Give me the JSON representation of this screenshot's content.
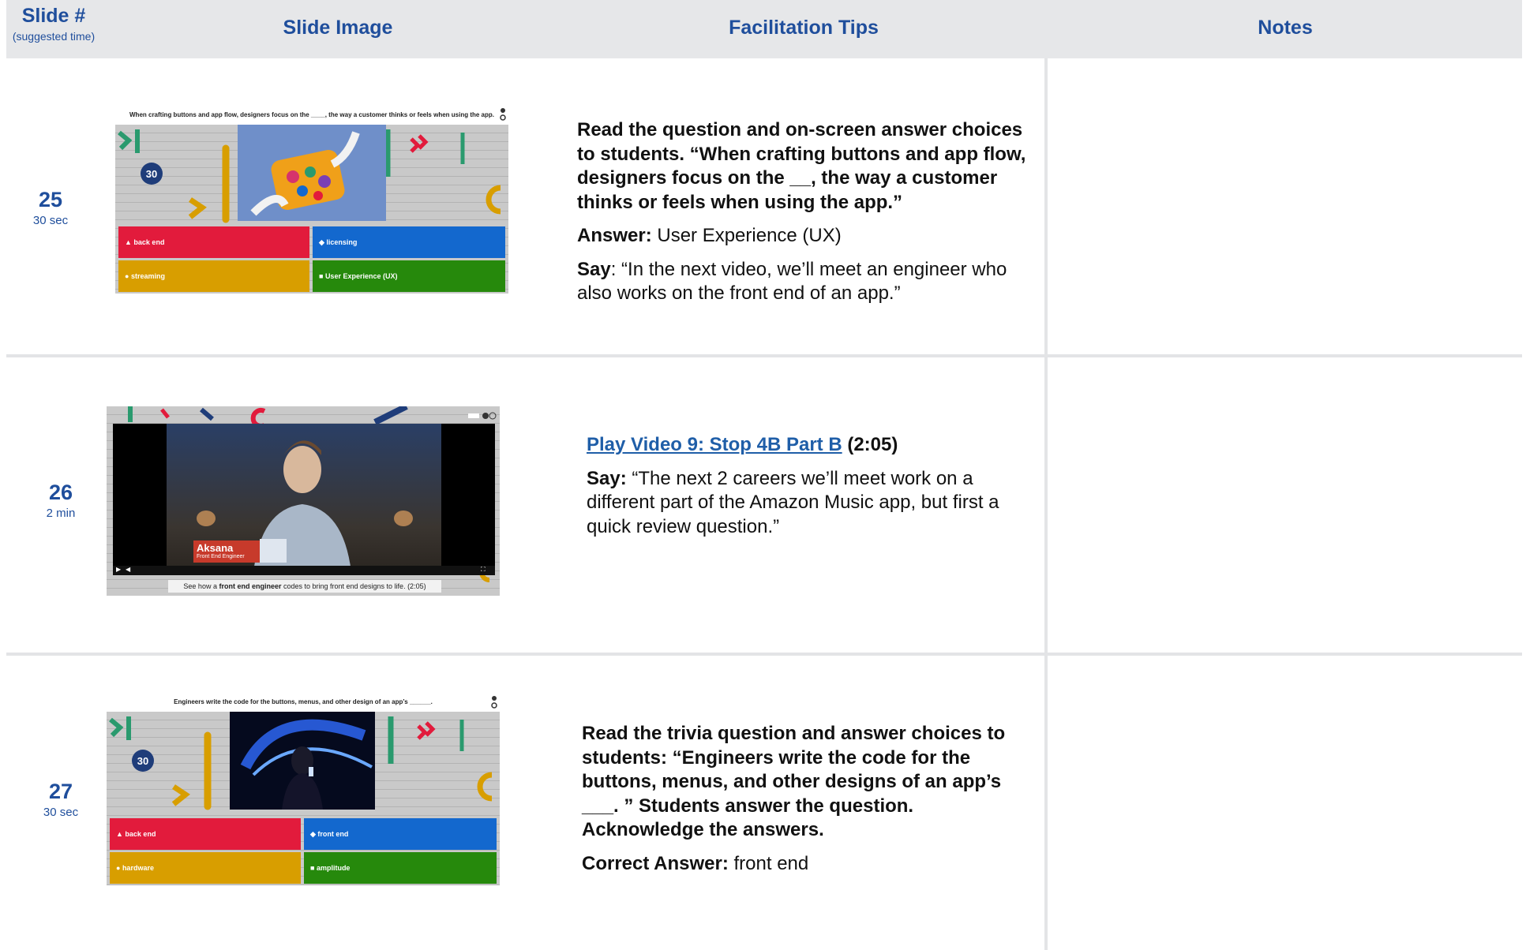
{
  "header": {
    "col1_title": "Slide #",
    "col1_sub": "(suggested time)",
    "col2_title": "Slide Image",
    "col3_title": "Facilitation Tips",
    "col4_title": "Notes"
  },
  "rows": [
    {
      "slide_number": "25",
      "time": "30 sec",
      "thumb": {
        "question": "When crafting buttons and app flow, designers focus on the ____, the way a customer thinks or feels when using the app.",
        "timer": "30",
        "answers": [
          "back end",
          "licensing",
          "streaming",
          "User Experience (UX)"
        ]
      },
      "tips": {
        "question": "Read the question and on-screen answer choices to students. “When crafting buttons and app flow, designers focus on the __, the way a customer thinks or feels when using the app.”",
        "answer_label": "Answer:",
        "answer_value": " User Experience (UX)",
        "say_label": "Say",
        "say_text": ": “In the next video, we’ll meet an engineer who also works on the front end of an app.”"
      }
    },
    {
      "slide_number": "26",
      "time": "2 min",
      "thumb": {
        "name_tag": "Aksana",
        "role_tag": "Front End Engineer",
        "caption_pre": "See how a ",
        "caption_bold": "front end engineer",
        "caption_post": " codes to bring front end designs to life. (2:05)"
      },
      "tips": {
        "link_text": "Play Video 9: Stop 4B Part B",
        "duration": " (2:05)",
        "say_label": "Say:",
        "say_text": " “The next 2 careers we’ll meet work on a different part of the Amazon Music app, but first a quick review question.”"
      }
    },
    {
      "slide_number": "27",
      "time": "30 sec",
      "thumb": {
        "question": "Engineers write the code for the buttons, menus, and other design of an app’s ______.",
        "timer": "30",
        "answers": [
          "back end",
          "front end",
          "hardware",
          "amplitude"
        ]
      },
      "tips": {
        "question": "Read the trivia question and answer choices to students: “Engineers write the code for the buttons, menus, and other designs of an app’s ___. ” Students answer the question. Acknowledge the answers.",
        "answer_label": "Correct Answer:",
        "answer_value": " front end"
      }
    }
  ],
  "colors": {
    "header_bg": "#e6e7e9",
    "heading_blue": "#1f4e9c",
    "answer_red": "#e21b3c",
    "answer_blue": "#1368ce",
    "answer_yellow": "#d89e00",
    "answer_green": "#26890c"
  }
}
